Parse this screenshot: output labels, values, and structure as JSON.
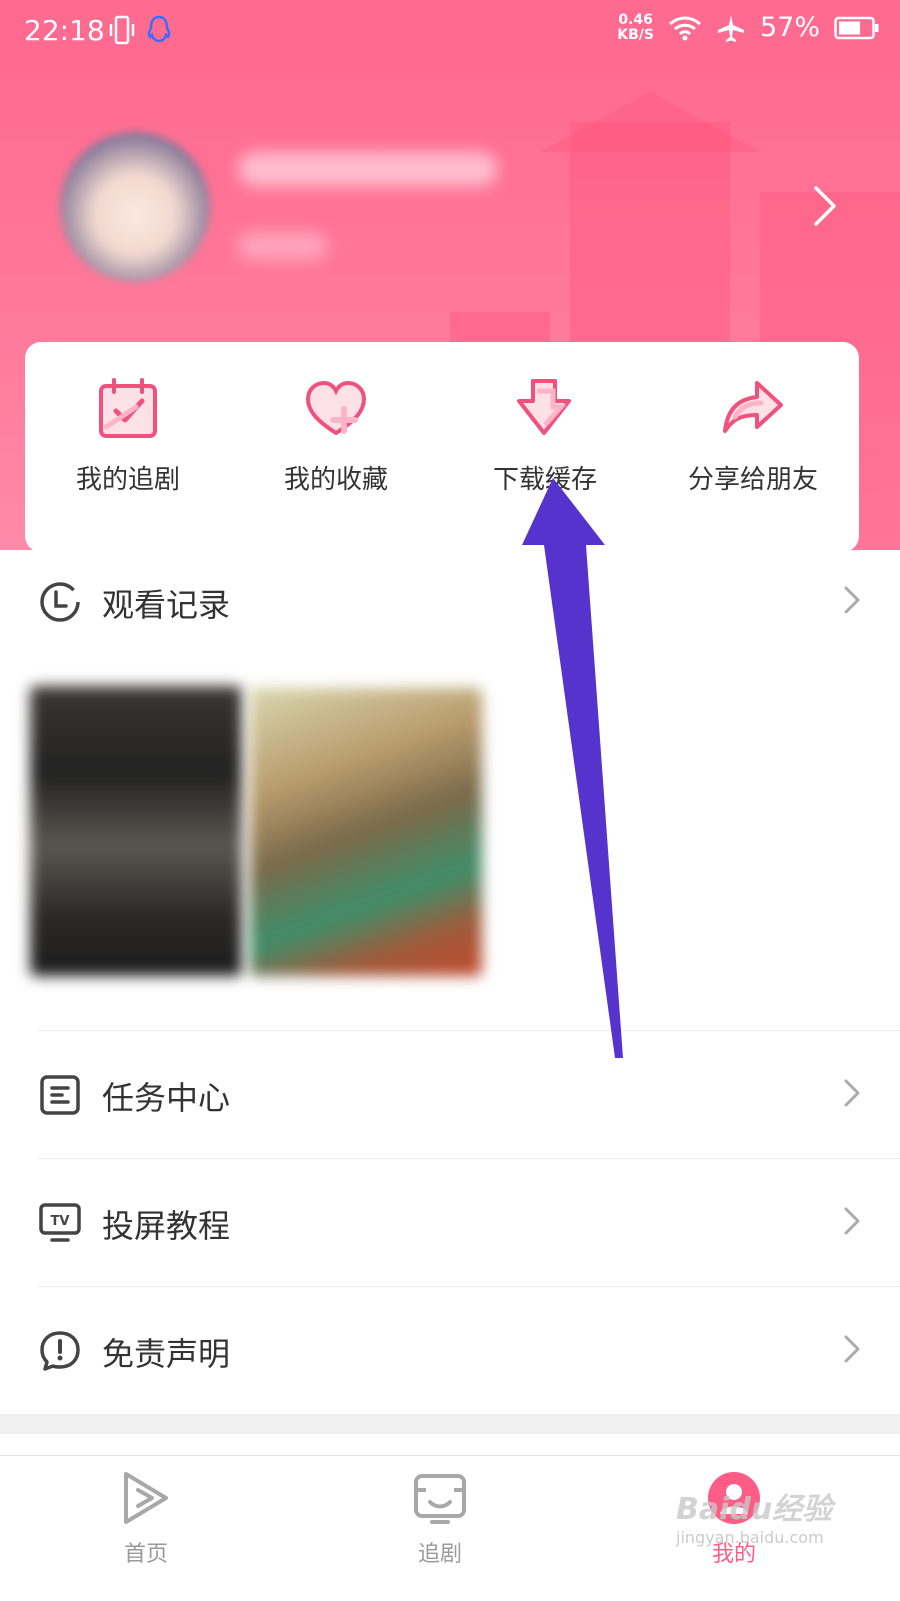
{
  "status_bar": {
    "time": "22:18",
    "net_speed_value": "0.46",
    "net_speed_unit": "KB/S",
    "battery": "57%"
  },
  "colors": {
    "brand_pink": "#ff6b90",
    "accent_pink": "#ff5c86",
    "annotation_arrow": "#5533cc"
  },
  "quick_actions": [
    {
      "label": "我的追剧",
      "icon": "calendar-check-icon"
    },
    {
      "label": "我的收藏",
      "icon": "heart-plus-icon"
    },
    {
      "label": "下载缓存",
      "icon": "download-arrow-icon"
    },
    {
      "label": "分享给朋友",
      "icon": "share-arrow-icon"
    }
  ],
  "menu": {
    "history": {
      "label": "观看记录",
      "icon": "clock-icon"
    },
    "tasks": {
      "label": "任务中心",
      "icon": "task-list-icon"
    },
    "cast": {
      "label": "投屏教程",
      "icon": "tv-icon"
    },
    "disclaimer": {
      "label": "免责声明",
      "icon": "exclamation-icon"
    }
  },
  "tab_bar": [
    {
      "label": "首页",
      "icon": "play-icon",
      "active": false
    },
    {
      "label": "追剧",
      "icon": "tv-screen-icon",
      "active": false
    },
    {
      "label": "我的",
      "icon": "profile-icon",
      "active": true
    }
  ],
  "watermark": {
    "brand": "Baidu经验",
    "url": "jingyan.baidu.com"
  }
}
